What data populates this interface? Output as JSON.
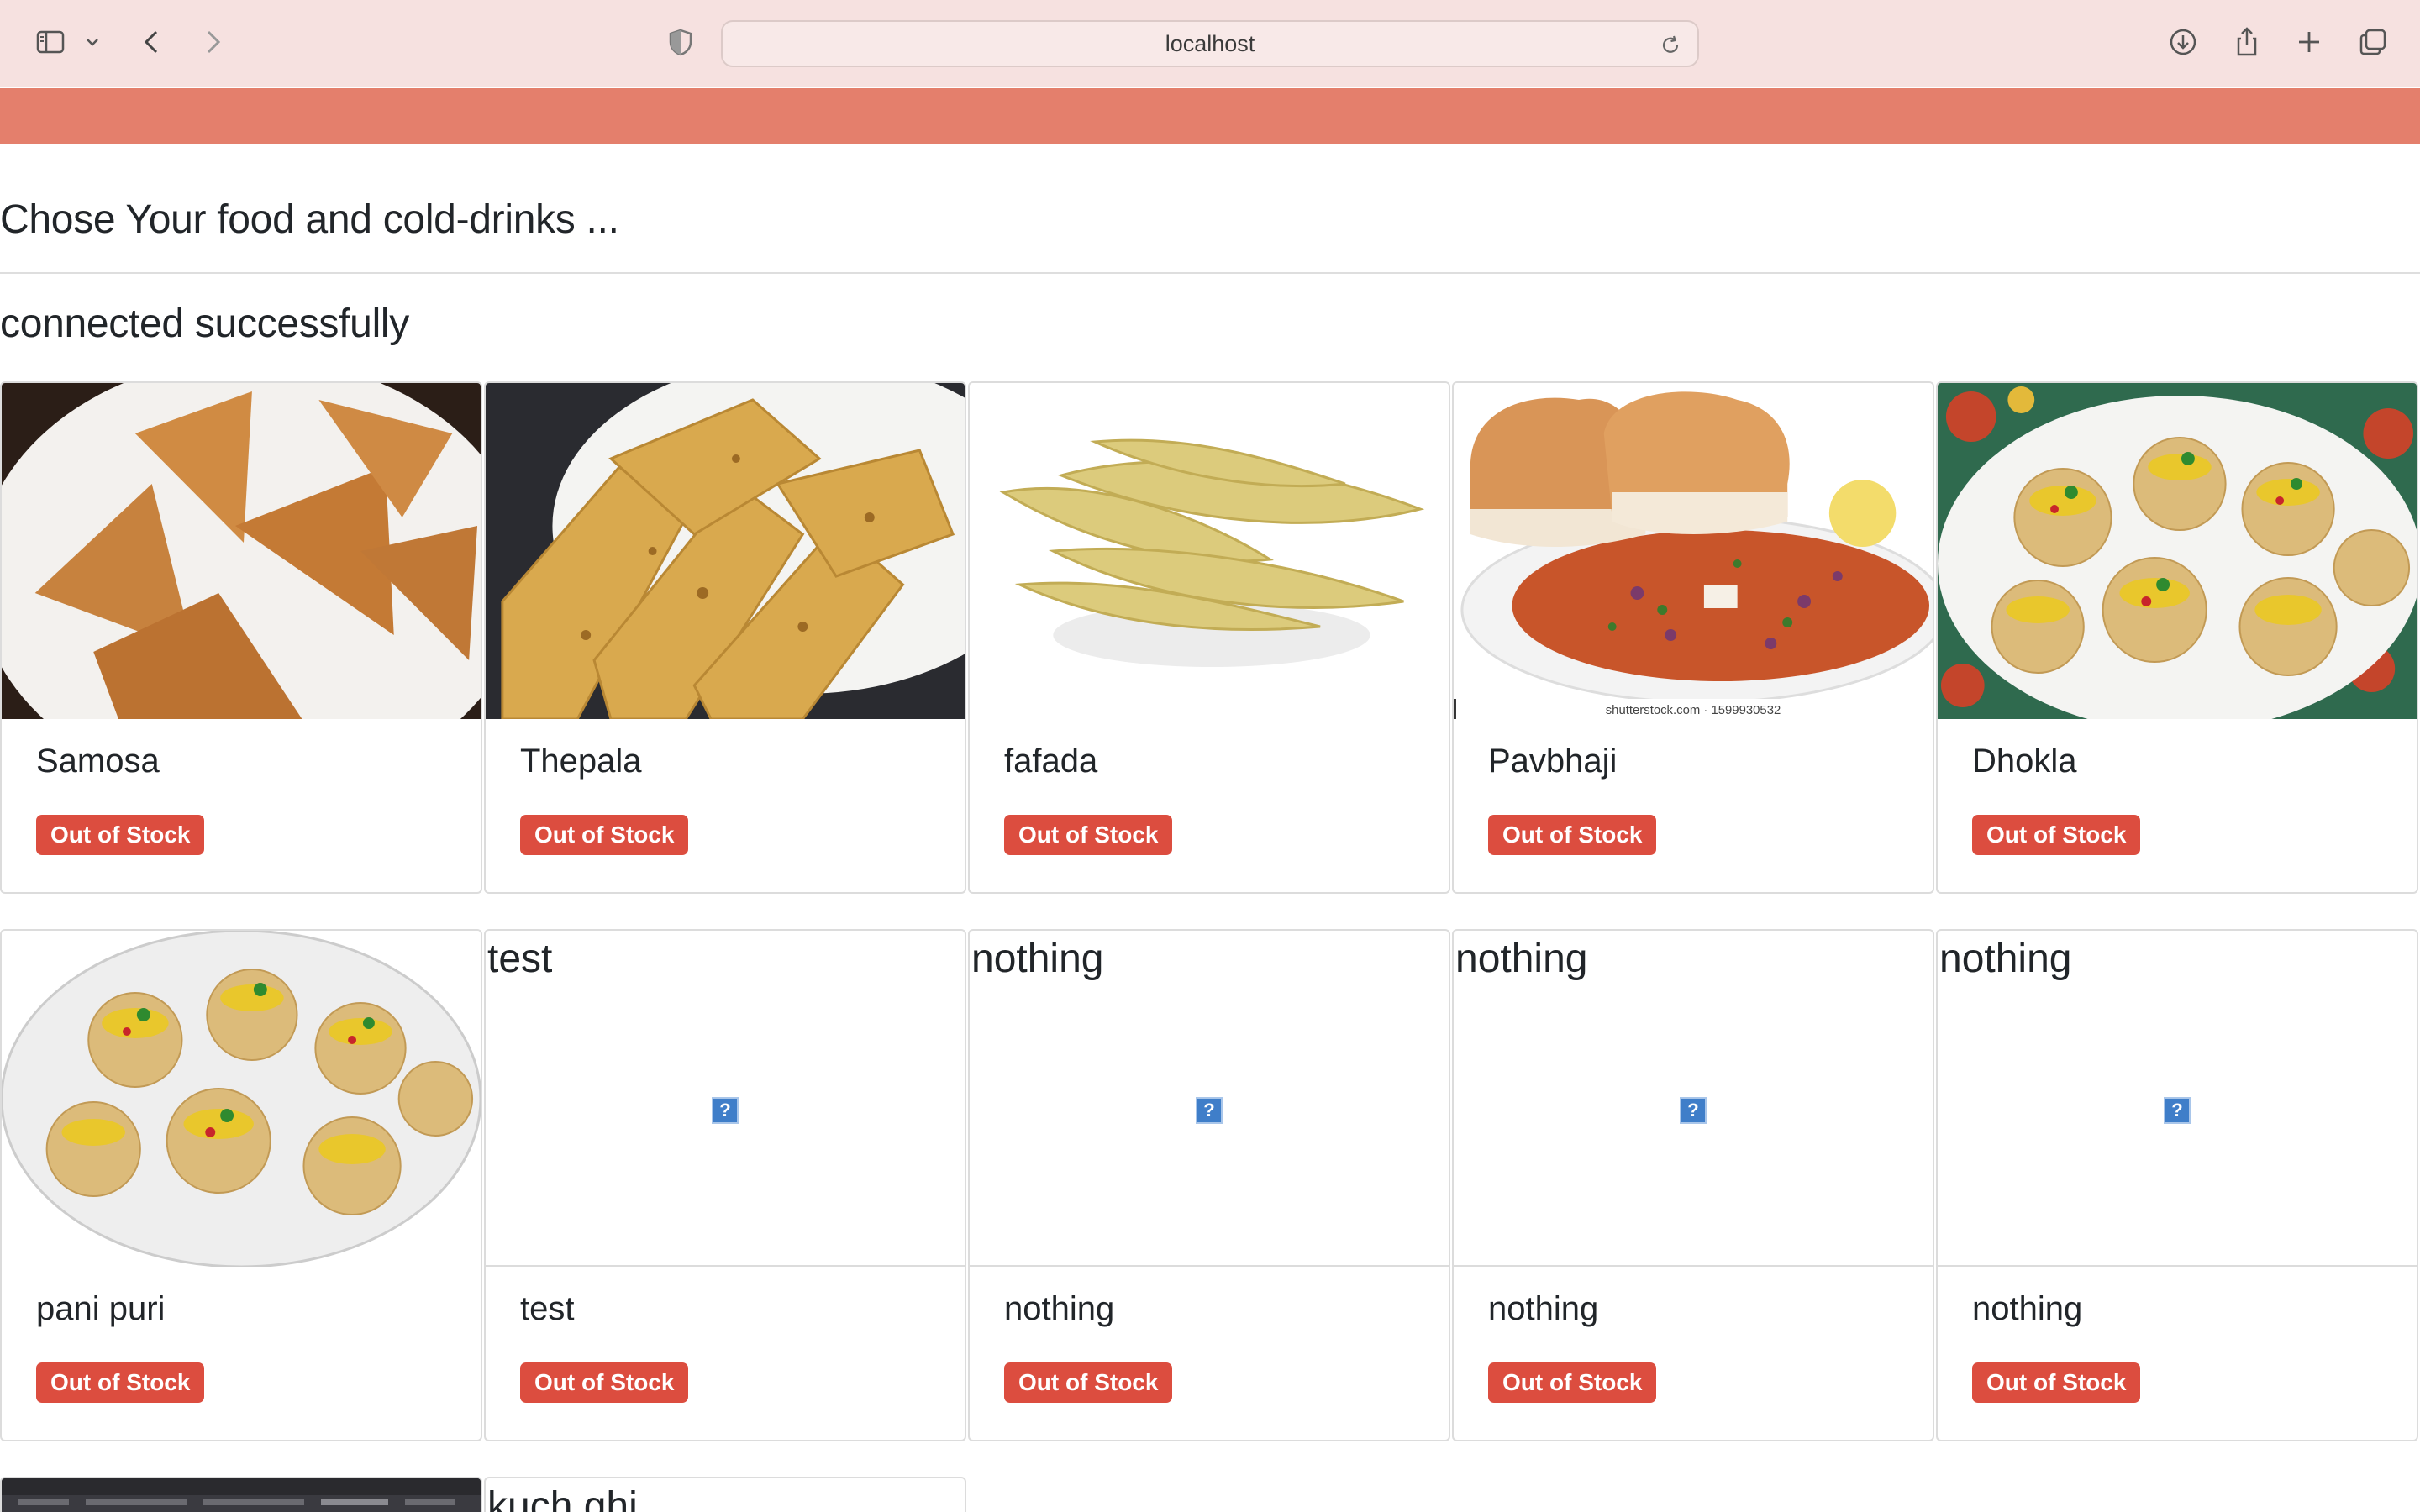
{
  "browser": {
    "url": "localhost",
    "icons": [
      "sidebar-icon",
      "chevron-down-icon",
      "back-icon",
      "forward-icon",
      "shield-icon",
      "reload-icon",
      "download-icon",
      "share-icon",
      "plus-icon",
      "tabs-icon"
    ]
  },
  "page": {
    "heading": "Chose Your food and cold-drinks ...",
    "status": "connected successfully",
    "accent_color": "#e47f6c",
    "badge_color": "#dc4d3f"
  },
  "items": [
    {
      "name": "Samosa",
      "badge": "Out of Stock"
    },
    {
      "name": "Thepala",
      "badge": "Out of Stock"
    },
    {
      "name": "fafada",
      "badge": "Out of Stock"
    },
    {
      "name": "Pavbhaji",
      "badge": "Out of Stock",
      "watermark": "shutterstock.com · 1599930532"
    },
    {
      "name": "Dhokla",
      "badge": "Out of Stock"
    },
    {
      "name": "pani puri",
      "badge": "Out of Stock"
    },
    {
      "name": "test",
      "alt": "test",
      "badge": "Out of Stock"
    },
    {
      "name": "nothing",
      "alt": "nothing",
      "badge": "Out of Stock"
    },
    {
      "name": "nothing",
      "alt": "nothing",
      "badge": "Out of Stock"
    },
    {
      "name": "nothing",
      "alt": "nothing",
      "badge": "Out of Stock"
    }
  ],
  "partial_items": [
    {
      "alt": "kuch ghi"
    }
  ],
  "broken_image_glyph": "?"
}
